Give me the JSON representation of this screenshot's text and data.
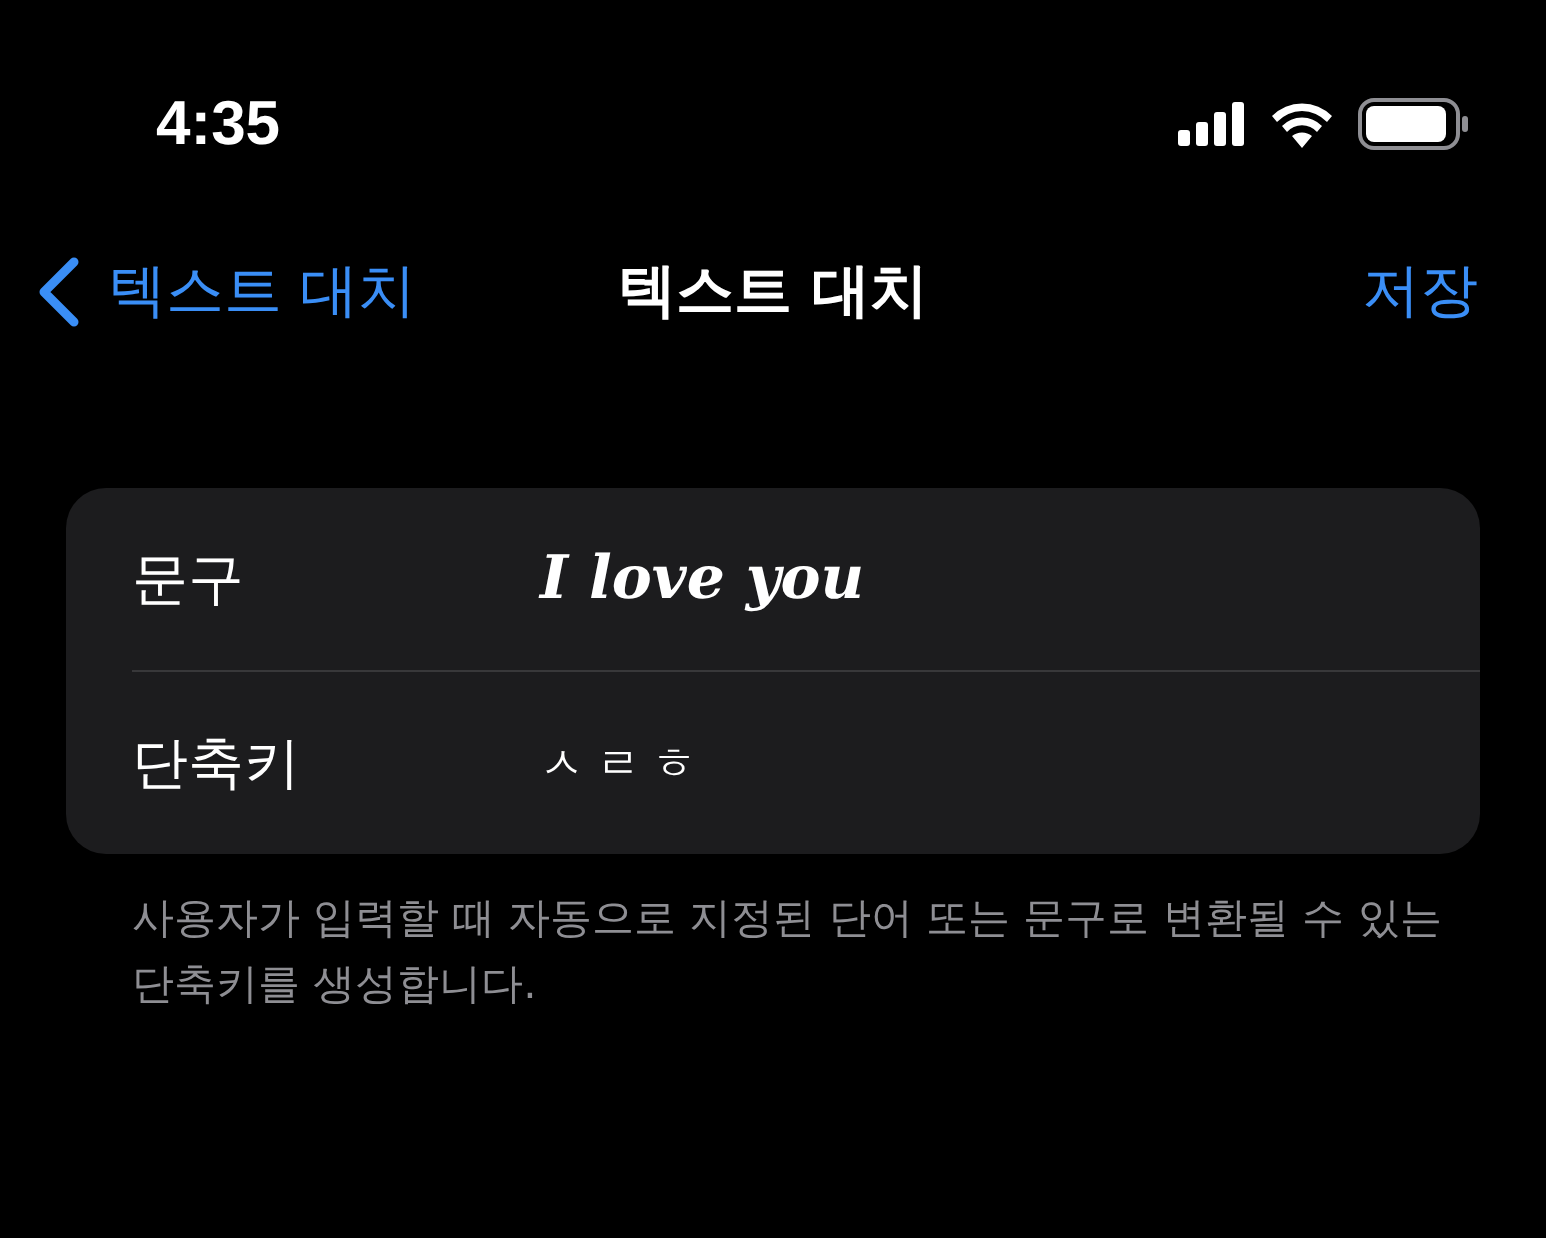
{
  "status_bar": {
    "time": "4:35"
  },
  "nav": {
    "back_label": "텍스트 대치",
    "title": "텍스트 대치",
    "action": "저장"
  },
  "form": {
    "rows": [
      {
        "label": "문구",
        "value": "I love you",
        "kind": "phrase"
      },
      {
        "label": "단축키",
        "value": "ㅅㄹㅎ",
        "kind": "shortcut"
      }
    ]
  },
  "footer_note": "사용자가 입력할 때 자동으로 지정된 단어 또는 문구로 변환될 수 있는 단축키를 생성합니다."
}
